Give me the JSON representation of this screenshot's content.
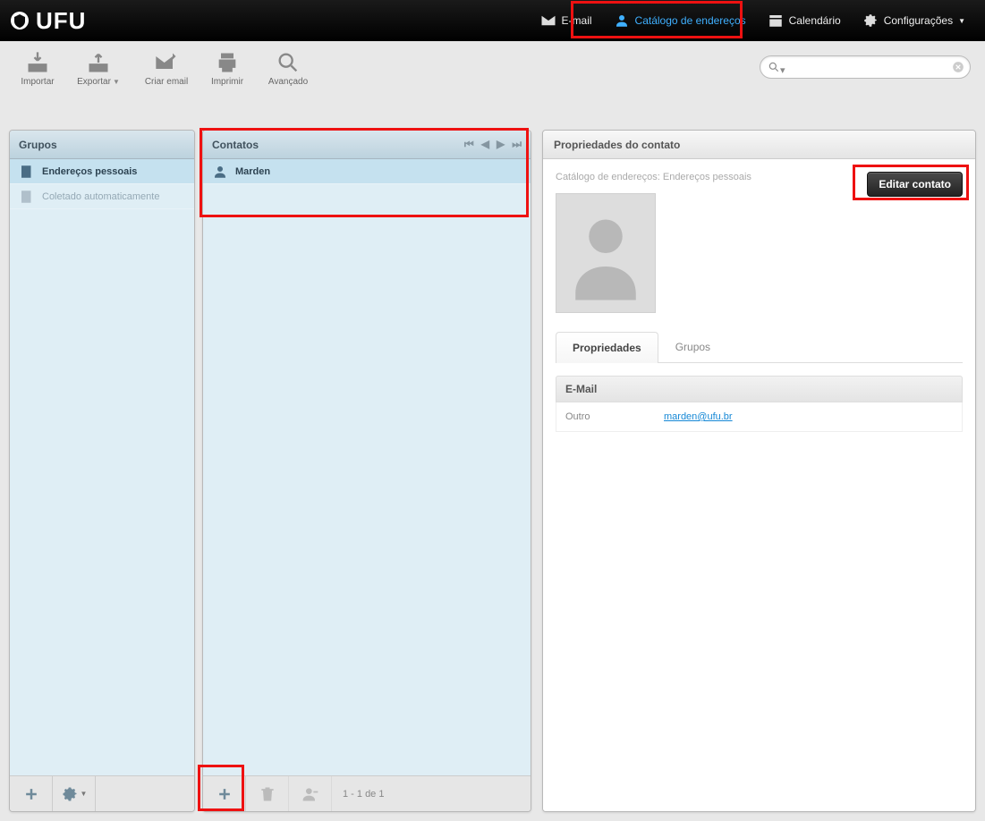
{
  "brand": "UFU",
  "nav": {
    "email": "E-mail",
    "addressbook": "Catálogo de endereços",
    "calendar": "Calendário",
    "settings": "Configurações"
  },
  "toolbar": {
    "import": "Importar",
    "export": "Exportar",
    "compose": "Criar email",
    "print": "Imprimir",
    "advanced": "Avançado"
  },
  "search": {
    "value": ""
  },
  "groups": {
    "title": "Grupos",
    "items": [
      {
        "label": "Endereços pessoais",
        "selected": true
      },
      {
        "label": "Coletado automaticamente",
        "selected": false
      }
    ]
  },
  "contacts": {
    "title": "Contatos",
    "items": [
      {
        "label": "Marden",
        "selected": true
      }
    ],
    "paging_text": "1 - 1 de 1"
  },
  "detail": {
    "title": "Propriedades do contato",
    "crumb": "Catálogo de endereços: Endereços pessoais",
    "edit_button": "Editar contato",
    "tabs": {
      "properties": "Propriedades",
      "groups": "Grupos"
    },
    "email_section": "E-Mail",
    "email_label": "Outro",
    "email_value": "marden@ufu.br"
  }
}
